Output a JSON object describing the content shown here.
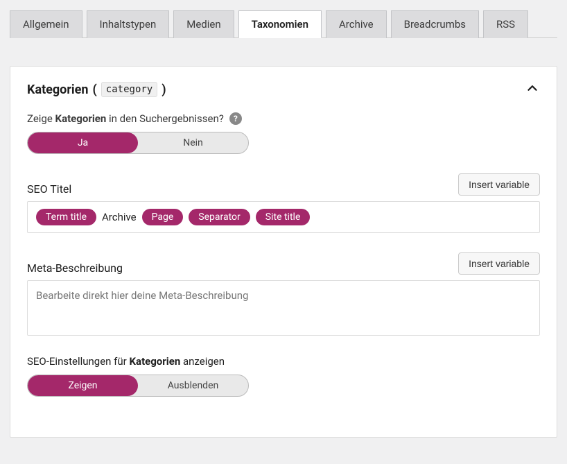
{
  "tabs": [
    "Allgemein",
    "Inhaltstypen",
    "Medien",
    "Taxonomien",
    "Archive",
    "Breadcrumbs",
    "RSS"
  ],
  "activeTab": 3,
  "panel": {
    "titlePrefix": "Kategorien",
    "slug": "category"
  },
  "search": {
    "prefix": "Zeige",
    "bold": "Kategorien",
    "suffix": "in den Suchergebnissen?",
    "yes": "Ja",
    "no": "Nein"
  },
  "seoTitle": {
    "label": "SEO Titel",
    "insertBtn": "Insert variable",
    "pills": [
      "Term title",
      "Page",
      "Separator",
      "Site title"
    ],
    "plainText": "Archive"
  },
  "metaDesc": {
    "label": "Meta-Beschreibung",
    "insertBtn": "Insert variable",
    "placeholder": "Bearbeite direkt hier deine Meta-Beschreibung"
  },
  "showSettings": {
    "prefix": "SEO-Einstellungen für",
    "bold": "Kategorien",
    "suffix": "anzeigen",
    "show": "Zeigen",
    "hide": "Ausblenden"
  }
}
